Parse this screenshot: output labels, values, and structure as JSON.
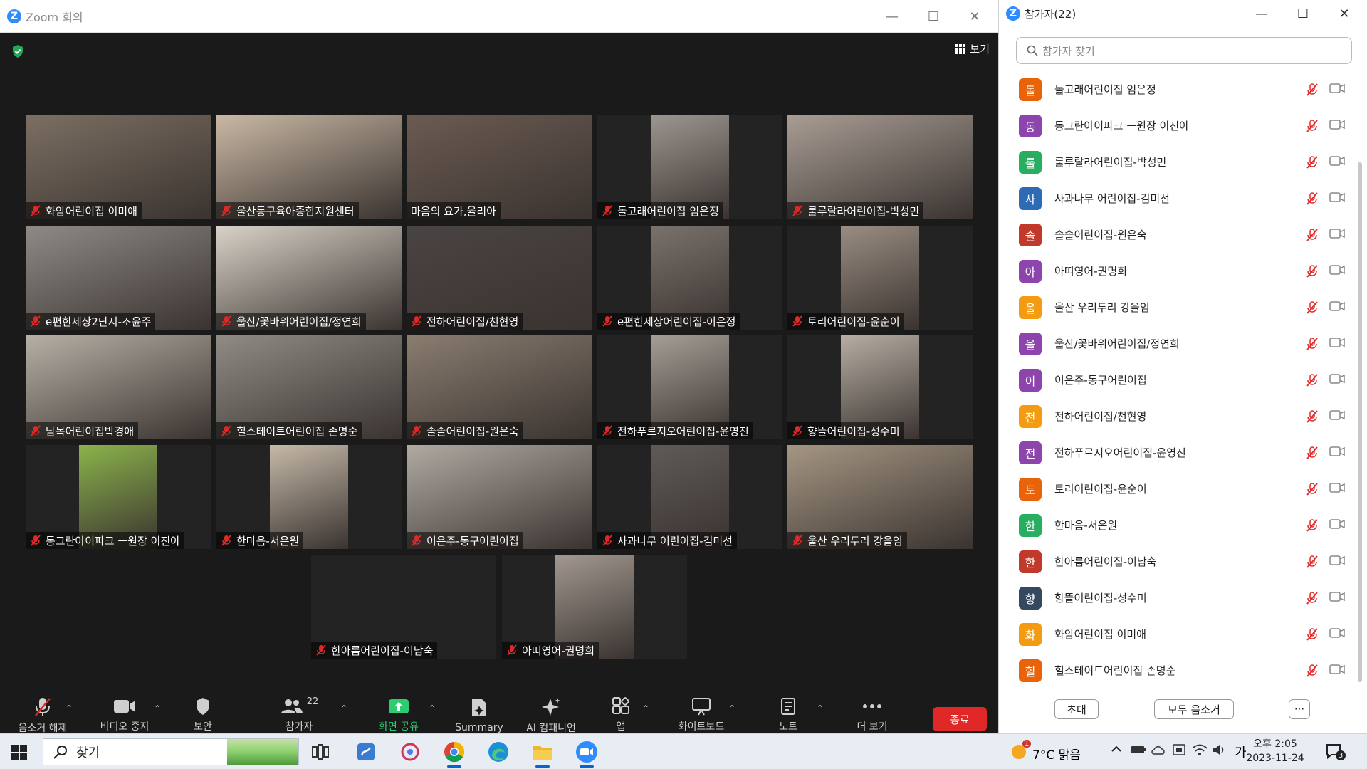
{
  "window": {
    "title": "Zoom 회의"
  },
  "view_button": {
    "label": "보기"
  },
  "participants_grid": [
    {
      "name": "화암어린이집 이미애",
      "video": "#7c6f62"
    },
    {
      "name": "울산동구육아종합지원센터",
      "video": "#c9b8a4"
    },
    {
      "name": "마음의 요가,율리아",
      "video": "#6b5b52",
      "active": true
    },
    {
      "name": "돌고래어린이집 임은정",
      "video": "#9c9690"
    },
    {
      "name": "룰루랄라어린이집-박성민",
      "video": "#a89d94"
    },
    {
      "name": "e편한세상2단지-조윤주",
      "video": "#8f8a86"
    },
    {
      "name": "울산/꽃바위어린이집/정연희",
      "video": "#d8d2c8"
    },
    {
      "name": "전하어린이집/천현영",
      "video": "#4a4442"
    },
    {
      "name": "e편한세상어린이집-이은정",
      "video": "#7a726c"
    },
    {
      "name": "토리어린이집-윤순이",
      "video": "#9a8d82"
    },
    {
      "name": "남목어린이집박경애",
      "video": "#b7b0a6"
    },
    {
      "name": "힐스테이트어린이집 손명순",
      "video": "#8e8c84"
    },
    {
      "name": "솔솔어린이집-원은숙",
      "video": "#8a7d70"
    },
    {
      "name": "전하푸르지오어린이집-윤영진",
      "video": "#a59e96"
    },
    {
      "name": "향뜰어린이집-성수미",
      "video": "#b6aea3"
    },
    {
      "name": "동그란아이파크 ㅡ원장 이진아",
      "video": "#8bb34b"
    },
    {
      "name": "한마음-서은원",
      "video": "#c5b9a8"
    },
    {
      "name": "이은주-동구어린이집",
      "video": "#b0aaa3"
    },
    {
      "name": "사과나무 어린이집-김미선",
      "video": "#5f5a58"
    },
    {
      "name": "울산 우리두리 강을임",
      "video": "#a59683"
    },
    {
      "name": "한아름어린이집-이남숙",
      "video": ""
    },
    {
      "name": "아띠영어-권명희",
      "video": "#a29890"
    }
  ],
  "toolbar": {
    "mute": "음소거 해제",
    "video": "비디오 중지",
    "security": "보안",
    "participants": "참가자",
    "participants_count": "22",
    "share": "화면 공유",
    "summary": "Summary",
    "ai": "AI 컴패니언",
    "apps": "앱",
    "whiteboard": "화이트보드",
    "notes": "노트",
    "more": "더 보기",
    "end": "종료"
  },
  "panel": {
    "title": "참가자(22)",
    "search_placeholder": "참가자 찾기",
    "invite": "초대",
    "mute_all": "모두 음소거",
    "more": "···",
    "list": [
      {
        "name": "돌고래어린이집 임은정",
        "initial": "돌",
        "color": "#e8630a"
      },
      {
        "name": "동그란아이파크 ㅡ원장 이진아",
        "initial": "동",
        "color": "#8e44ad"
      },
      {
        "name": "룰루랄라어린이집-박성민",
        "initial": "룰",
        "color": "#27ae60"
      },
      {
        "name": "사과나무 어린이집-김미선",
        "initial": "사",
        "color": "#2d6cb5"
      },
      {
        "name": "솔솔어린이집-원은숙",
        "initial": "솔",
        "color": "#c0392b"
      },
      {
        "name": "아띠영어-권명희",
        "initial": "아",
        "color": "#8e44ad"
      },
      {
        "name": "울산 우리두리 강을임",
        "initial": "울",
        "color": "#f39c12"
      },
      {
        "name": "울산/꽃바위어린이집/정연희",
        "initial": "울",
        "color": "#8e44ad"
      },
      {
        "name": "이은주-동구어린이집",
        "initial": "이",
        "color": "#8e44ad"
      },
      {
        "name": "전하어린이집/천현영",
        "initial": "전",
        "color": "#f39c12"
      },
      {
        "name": "전하푸르지오어린이집-윤영진",
        "initial": "전",
        "color": "#8e44ad"
      },
      {
        "name": "토리어린이집-윤순이",
        "initial": "토",
        "color": "#e8630a"
      },
      {
        "name": "한마음-서은원",
        "initial": "한",
        "color": "#27ae60"
      },
      {
        "name": "한아름어린이집-이남숙",
        "initial": "한",
        "color": "#c0392b"
      },
      {
        "name": "향뜰어린이집-성수미",
        "initial": "향",
        "color": "#34495e"
      },
      {
        "name": "화암어린이집 이미애",
        "initial": "화",
        "color": "#f39c12"
      },
      {
        "name": "힐스테이트어린이집 손명순",
        "initial": "힐",
        "color": "#e8630a"
      }
    ]
  },
  "taskbar": {
    "search": "찾기",
    "weather_badge": "1",
    "weather": "7°C 맑음",
    "ime": "가",
    "time_ampm": "오후 2:05",
    "date": "2023-11-24",
    "notifications": "3"
  }
}
